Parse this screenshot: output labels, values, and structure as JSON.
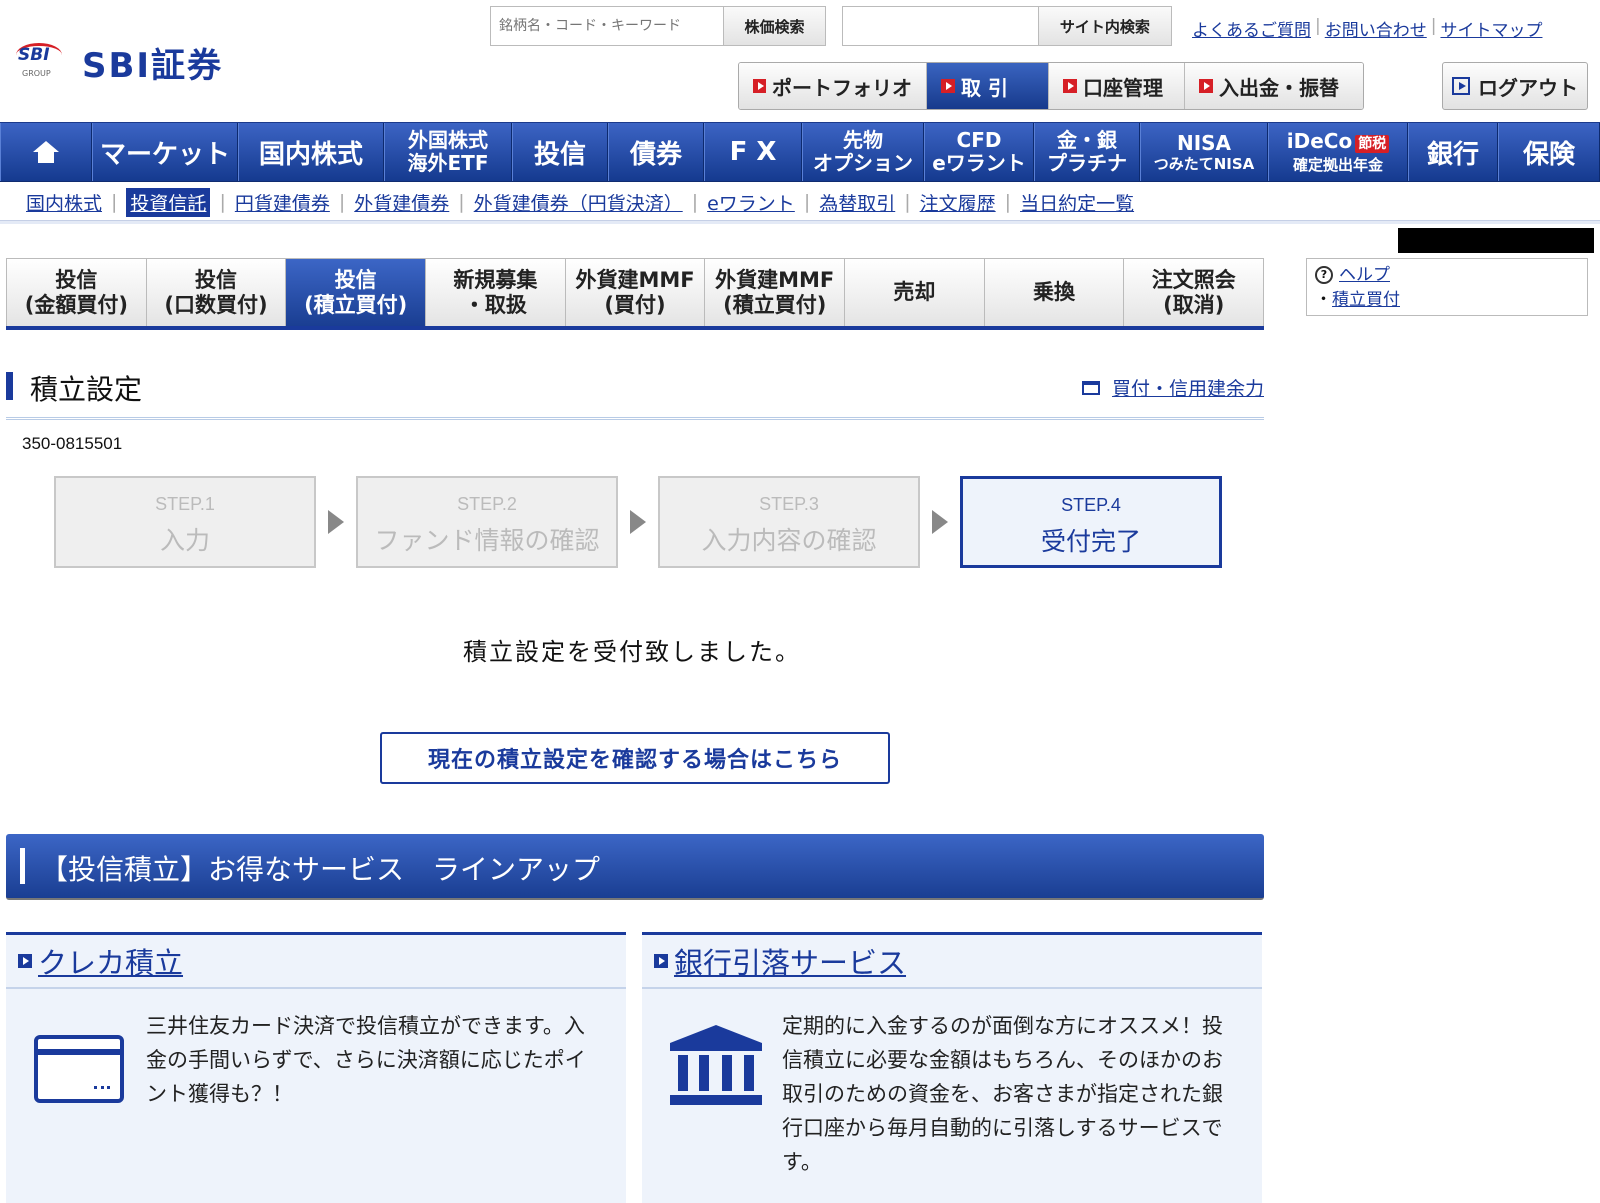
{
  "brand": {
    "name": "SBI証券",
    "mark_text": "SBI",
    "mark_sub": "GROUP",
    "color": "#1a3a9c",
    "accent": "#d61f26"
  },
  "search": {
    "stock_placeholder": "銘柄名・コード・キーワード",
    "stock_button": "株価検索",
    "site_placeholder": "",
    "site_button": "サイト内検索"
  },
  "util_links": [
    "よくあるご質問",
    "お問い合わせ",
    "サイトマップ"
  ],
  "top_tabs": [
    "ポートフォリオ",
    "取 引",
    "口座管理",
    "入出金・振替"
  ],
  "logout": "ログアウト",
  "main_nav": {
    "market": "マーケット",
    "domestic": "国内株式",
    "foreign_1": "外国株式",
    "foreign_2": "海外ETF",
    "toshin": "投信",
    "bonds": "債券",
    "fx": "F X",
    "futures_1": "先物",
    "futures_2": "オプション",
    "cfd_1": "CFD",
    "cfd_2": "eワラント",
    "gold_1": "金・銀",
    "gold_2": "プラチナ",
    "nisa_1": "NISA",
    "nisa_2": "つみたてNISA",
    "ideco_1": "iDeCo",
    "ideco_badge": "節税",
    "ideco_2": "確定拠出年金",
    "bank": "銀行",
    "insurance": "保険"
  },
  "sub_nav": [
    "国内株式",
    "投資信託",
    "円貨建債券",
    "外貨建債券",
    "外貨建債券（円貨決済）",
    "eワラント",
    "為替取引",
    "注文履歴",
    "当日約定一覧"
  ],
  "fund_tabs": [
    {
      "l1": "投信",
      "l2": "(金額買付)"
    },
    {
      "l1": "投信",
      "l2": "(口数買付)"
    },
    {
      "l1": "投信",
      "l2": "(積立買付)"
    },
    {
      "l1": "新規募集",
      "l2": "・取扱"
    },
    {
      "l1": "外貨建MMF",
      "l2": "(買付)"
    },
    {
      "l1": "外貨建MMF",
      "l2": "(積立買付)"
    },
    {
      "l1": "売却",
      "l2": ""
    },
    {
      "l1": "乗換",
      "l2": ""
    },
    {
      "l1": "注文照会",
      "l2": "(取消)"
    }
  ],
  "help": {
    "icon_text": "?",
    "title": "ヘルプ",
    "item": "積立買付",
    "bullet": "・"
  },
  "section": {
    "title": "積立設定",
    "link": "買付・信用建余力"
  },
  "account_no": "350-0815501",
  "steps": [
    {
      "n": "STEP.1",
      "label": "入力"
    },
    {
      "n": "STEP.2",
      "label": "ファンド情報の確認"
    },
    {
      "n": "STEP.3",
      "label": "入力内容の確認"
    },
    {
      "n": "STEP.4",
      "label": "受付完了"
    }
  ],
  "done_message": "積立設定を受付致しました。",
  "confirm_button": "現在の積立設定を確認する場合はこちら",
  "lineup_title": "【投信積立】お得なサービス　ラインアップ",
  "cards": [
    {
      "title": "クレカ積立",
      "body": "三井住友カード決済で投信積立ができます。入金の手間いらずで、さらに決済額に応じたポイント獲得も？！"
    },
    {
      "title": "銀行引落サービス",
      "body": "定期的に入金するのが面倒な方にオススメ！投信積立に必要な金額はもちろん、そのほかのお取引のための資金を、お客さまが指定された銀行口座から毎月自動的に引落しするサービスです。"
    }
  ]
}
